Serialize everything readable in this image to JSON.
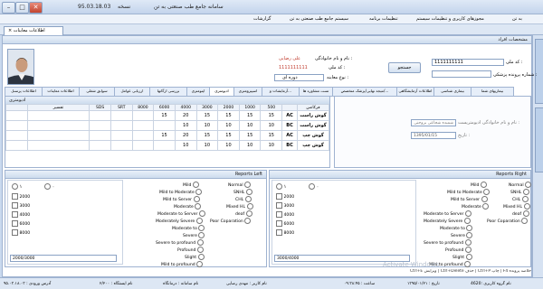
{
  "window": {
    "title": "سامانه جامع طب صنعتی به تن",
    "version_label": "نسخه",
    "version": "95.03.18.03"
  },
  "menu": [
    "به تن",
    "مجوزهای کاربری و تنظیمات سیستم",
    "تنظیمات برنامه",
    "سیستم جامع طب صنعتی به تن",
    "گزارشات"
  ],
  "doc_tab": "اطلاعات معاینات",
  "side_tabs": [
    "امکانات",
    "اطلاعات مراجعه"
  ],
  "person": {
    "section": "مشخصات افراد",
    "code_label": "کد ملی :",
    "code_value": "1111111111",
    "file_label": "شماره پرونده پزشکی :",
    "name_label": "نام و نام خانوادگی :",
    "name_value": "علی رضایی",
    "nid_label": "کد ملی :",
    "nid_value": "1111111111",
    "jobtype_label": "نوع معاینه :",
    "jobtype_value": "دوره ای",
    "search_button": "جستجو"
  },
  "subtabs": [
    "اطلاعات پرسنل",
    "اطلاعات معاینات",
    "سوابق شغلی",
    "ارزیابی عوامل",
    "بررسی ارگانها",
    "اپتومتری",
    "ادیومتری",
    "اسپیرومتری",
    "آزمایشات و...",
    "تست مشاوره ها",
    "نتیجه نهایی/پزشک متخصص/...",
    "اطلاعات آزمایشگاهی",
    "بیماری شناسی",
    "بیماریهای شما"
  ],
  "audiometry": {
    "section": "ادیومتری",
    "headers": [
      "فرکانس",
      "500",
      "1000",
      "2000",
      "3000",
      "4000",
      "6000",
      "8000",
      "SRT",
      "SDS",
      "تفسیر"
    ],
    "rows": [
      {
        "label": "گوش راست",
        "type": "AC",
        "values": [
          "15",
          "15",
          "15",
          "15",
          "20",
          "15",
          "",
          "",
          ""
        ]
      },
      {
        "label": "گوش راست",
        "type": "BC",
        "values": [
          "10",
          "10",
          "10",
          "10",
          "10",
          "",
          "",
          "",
          ""
        ]
      },
      {
        "label": "گوش چپ",
        "type": "AC",
        "values": [
          "15",
          "15",
          "15",
          "15",
          "20",
          "15",
          "",
          "",
          ""
        ]
      },
      {
        "label": "گوش چپ",
        "type": "BC",
        "values": [
          "10",
          "10",
          "10",
          "10",
          "10",
          "",
          "",
          "",
          ""
        ]
      }
    ],
    "examiner_label": "نام و نام خانوادگی ادیومتریست :",
    "examiner_value": "شمیده شجاعی بروجنی",
    "date_label": "تاریخ :",
    "date_value": "1395/01/15"
  },
  "reports_left": {
    "title": "Reports Left",
    "items": [
      "Normal",
      "Mild",
      "SNHL",
      "Mild to Moderate",
      "CHL",
      "Mild to Server",
      "Mixed HL",
      "Moderate",
      "deaf",
      "Moderate to Server",
      "Poor Coparation",
      "Moderately Severe",
      "Moderate to",
      "Severe",
      "Severe to profound",
      "Profound",
      "Slight",
      "Mild to profound"
    ],
    "freqs": [
      "2000",
      "3000",
      "4000",
      "6000",
      "8000"
    ],
    "range": "2000/3000"
  },
  "reports_right": {
    "title": "Reports Right",
    "items": [
      "Normal",
      "Mild",
      "SNHL",
      "Mild to Moderate",
      "CHL",
      "Mild to Server",
      "Mixed HL",
      "Moderate",
      "deaf",
      "Moderate to Server",
      "Poor Coparation",
      "Moderately Severe",
      "Moderate to",
      "Severe",
      "Severe to profound",
      "Profound",
      "Slight",
      "Mild to profound"
    ],
    "freqs": [
      "2000",
      "3000",
      "4000",
      "6000",
      "8000"
    ],
    "range": "3000/4000"
  },
  "shortcuts": "Ctrl+E ویرایش | Ctrl+Delete حذف | Ctrl+P چاپ | F4 خلاصه پرونده",
  "watermark": "Activate Windows",
  "status": {
    "user": "نام کاربر : مهدی رضایی",
    "group": "نام گروه کاربری :4620",
    "date": "تاریخ : ۱۳۹۵/۰۱/۲۱",
    "time": "ساعت : ۰۹:۳۸:۴۵",
    "station": "نام ایستگاه : ۲/۲۰۰",
    "center": "نام سامانه : درمانگاه",
    "ip": "آدرس ورودی : ۹۵.۰۳.۱۸.۰۳"
  }
}
